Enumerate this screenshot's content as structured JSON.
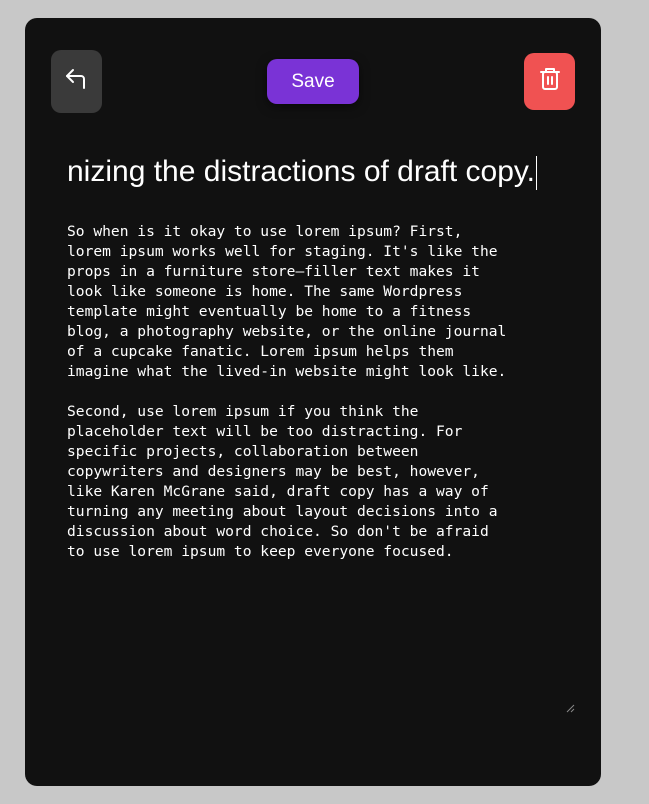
{
  "toolbar": {
    "back_icon": "undo-arrow-icon",
    "save_label": "Save",
    "delete_icon": "trash-icon"
  },
  "note": {
    "title_visible": "nizing the distractions of draft copy.",
    "body": "So when is it okay to use lorem ipsum? First,\nlorem ipsum works well for staging. It's like the\nprops in a furniture store—filler text makes it\nlook like someone is home. The same Wordpress\ntemplate might eventually be home to a fitness\nblog, a photography website, or the online journal\nof a cupcake fanatic. Lorem ipsum helps them\nimagine what the lived-in website might look like.\n\nSecond, use lorem ipsum if you think the\nplaceholder text will be too distracting. For\nspecific projects, collaboration between\ncopywriters and designers may be best, however,\nlike Karen McGrane said, draft copy has a way of\nturning any meeting about layout decisions into a\ndiscussion about word choice. So don't be afraid\nto use lorem ipsum to keep everyone focused."
  },
  "colors": {
    "background": "#c8c8c8",
    "card": "#111111",
    "back_button": "#3a3a3a",
    "save_button": "#7a33d6",
    "delete_button": "#f05252"
  }
}
